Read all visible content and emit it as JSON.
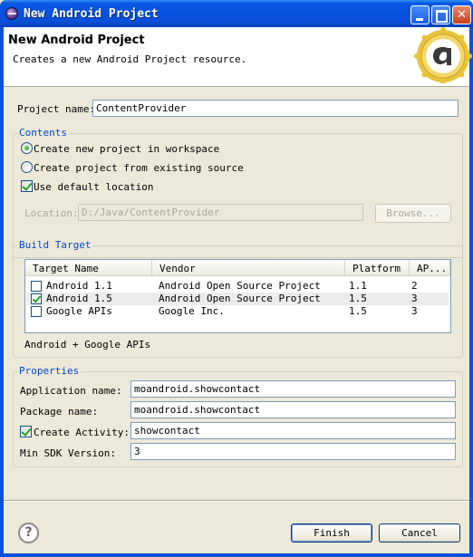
{
  "window": {
    "title": "New Android Project"
  },
  "banner": {
    "title": "New Android Project",
    "description": "Creates a new Android Project resource."
  },
  "project_name": {
    "label": "Project name:",
    "value": "ContentProvider"
  },
  "contents": {
    "title": "Contents",
    "option_new": "Create new project in workspace",
    "option_existing": "Create project from existing source",
    "use_default": "Use default location",
    "location_label": "Location:",
    "location_value": "D:/Java/ContentProvider",
    "browse": "Browse..."
  },
  "build_target": {
    "title": "Build Target",
    "headers": [
      "Target Name",
      "Vendor",
      "Platform",
      "AP..."
    ],
    "rows": [
      {
        "name": "Android 1.1",
        "vendor": "Android Open Source Project",
        "platform": "1.1",
        "api": "2",
        "checked": false
      },
      {
        "name": "Android 1.5",
        "vendor": "Android Open Source Project",
        "platform": "1.5",
        "api": "3",
        "checked": true
      },
      {
        "name": "Google APIs",
        "vendor": "Google Inc.",
        "platform": "1.5",
        "api": "3",
        "checked": false
      }
    ],
    "description": "Android + Google APIs"
  },
  "properties": {
    "title": "Properties",
    "app_name_label": "Application name:",
    "app_name_value": "moandroid.showcontact",
    "package_label": "Package name:",
    "package_value": "moandroid.showcontact",
    "activity_label": "Create Activity:",
    "activity_value": "showcontact",
    "min_sdk_label": "Min SDK Version:",
    "min_sdk_value": "3"
  },
  "buttons": {
    "finish": "Finish",
    "cancel": "Cancel",
    "help": "?"
  }
}
